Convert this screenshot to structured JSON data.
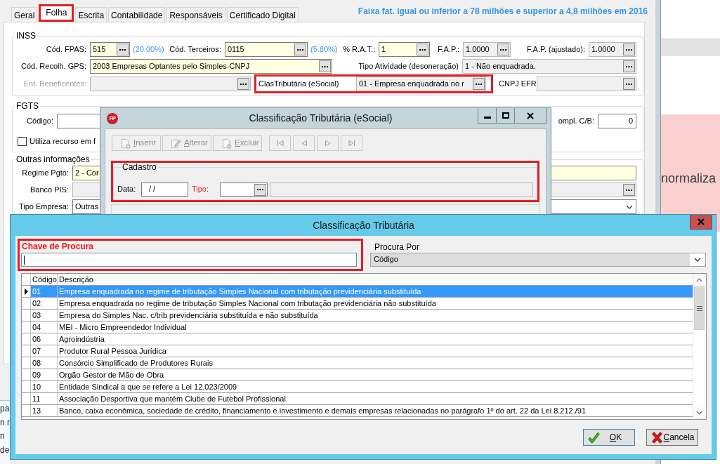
{
  "main_window": {
    "tabs": [
      {
        "label": "Geral",
        "selected": false,
        "highlighted": false
      },
      {
        "label": "Folha",
        "selected": true,
        "highlighted": true
      },
      {
        "label": "Escrita",
        "selected": false,
        "highlighted": false
      },
      {
        "label": "Contabilidade",
        "selected": false,
        "highlighted": false
      },
      {
        "label": "Responsáveis",
        "selected": false,
        "highlighted": false
      },
      {
        "label": "Certificado Digital",
        "selected": false,
        "highlighted": false
      }
    ],
    "notice": "Faixa fat. igual ou inferior a 78 milhões e superior a 4,8 milhões em 2016",
    "inss": {
      "title": "INSS",
      "fpas": {
        "label": "Cód. FPAS:",
        "value": "515",
        "kind": "required",
        "rate": "(20.00%)"
      },
      "third_parties": {
        "label": "Cód. Terceiros:",
        "value": "0115",
        "kind": "required",
        "rate": "(5.80%)"
      },
      "rat": {
        "label": "% R.A.T.:",
        "value": "1",
        "kind": "required"
      },
      "fap": {
        "label": "F.A.P.:",
        "value": "1.0000",
        "kind": "readonly"
      },
      "fap_adjusted": {
        "label": "F.A.P. (ajustado):",
        "value": "1.0000",
        "kind": "readonly"
      },
      "gps_code": {
        "label": "Cód. Recolh. GPS:",
        "value": "2003 Empresas Optantes pelo Simples-CNPJ",
        "kind": "required"
      },
      "activity_type": {
        "label": "Tipo Atividade (desoneração)",
        "value": "1 - Não enquadrada.",
        "kind": "readonly"
      },
      "beneficent": {
        "label": "Ent. Beneficentes:",
        "kind": "readonly",
        "disabled": true
      },
      "tax_class": {
        "label": "ClasTributária (eSocial)",
        "value": "01 - Empresa enquadrada no r",
        "kind": "readonly",
        "highlighted": true
      },
      "cnpj_efr": {
        "label": "CNPJ EFR",
        "kind": "readonly"
      }
    },
    "fgts": {
      "title": "FGTS",
      "code": {
        "label": "Código:",
        "kind": "plain"
      },
      "uses_resource": {
        "label": "Utiliza recurso em f",
        "checked": false
      },
      "compl_cb": {
        "label": "ompl. C/B:",
        "value": "0",
        "kind": "plain"
      }
    },
    "other_info": {
      "title": "Outras informações",
      "payment_regime": {
        "label": "Regime Pgto:",
        "value": "2 - Cor",
        "kind": "required"
      },
      "pis_bank": {
        "label": "Banco PIS:",
        "kind": "readonly"
      },
      "company_type": {
        "label": "Tipo Empresa:",
        "value": "Outras",
        "kind": "plain"
      }
    }
  },
  "side_window": {
    "banner": "normaliza"
  },
  "back_window": {
    "lines": [
      "pa",
      "n r",
      "n",
      "de"
    ]
  },
  "esocial_dialog": {
    "logo": "FP",
    "title": "Classificação Tributária (eSocial)",
    "toolbar": [
      {
        "label": "Inserir",
        "kind": "insert",
        "disabled": true,
        "mnemonic": true
      },
      {
        "label": "Alterar",
        "kind": "edit",
        "disabled": true,
        "mnemonic": true
      },
      {
        "label": "Excluir",
        "kind": "delete",
        "disabled": true,
        "mnemonic": true
      }
    ],
    "navigator": [
      {
        "kind": "first",
        "disabled": true
      },
      {
        "kind": "prev",
        "disabled": true
      },
      {
        "kind": "next",
        "disabled": true
      },
      {
        "kind": "last",
        "disabled": true
      }
    ],
    "record": {
      "title": "Cadastro",
      "highlighted": true,
      "date": {
        "label": "Data:",
        "value": "/ /",
        "required": false
      },
      "type": {
        "label": "Tipo:",
        "required": true
      }
    }
  },
  "lookup_dialog": {
    "title": "Classificação Tributária",
    "search_key": {
      "label": "Chave de Procura",
      "required": true,
      "highlighted": true
    },
    "search_by": {
      "label": "Procura Por",
      "value": "Código"
    },
    "table": {
      "columns": [
        "Código",
        "Descrição"
      ],
      "rows": [
        {
          "code": "01",
          "description": "Empresa enquadrada no regime de tributação Simples Nacional com tributação previdenciária substituída",
          "selected": true
        },
        {
          "code": "02",
          "description": "Empresa enquadrada no regime de tributação Simples Nacional com tributação previdenciária não substituída",
          "selected": false
        },
        {
          "code": "03",
          "description": "Empresa do Simples Nac. c/trib previdenciária substituída e não substituída",
          "selected": false
        },
        {
          "code": "04",
          "description": "MEI - Micro Empreendedor Individual",
          "selected": false
        },
        {
          "code": "06",
          "description": "Agroindústria",
          "selected": false
        },
        {
          "code": "07",
          "description": "Produtor Rural Pessoa Jurídica",
          "selected": false
        },
        {
          "code": "08",
          "description": "Consórcio Simplificado de Produtores Rurais",
          "selected": false
        },
        {
          "code": "09",
          "description": "Orgão Gestor de Mão de Obra",
          "selected": false
        },
        {
          "code": "10",
          "description": "Entidade Sindical a que se refere a Lei 12.023/2009",
          "selected": false
        },
        {
          "code": "11",
          "description": "Associação Desportiva que mantém Clube de Futebol Profissional",
          "selected": false
        },
        {
          "code": "13",
          "description": "Banco, caixa econômica, sociedade de crédito, financiamento e investimento e demais empresas relacionadas no parágrafo 1º do art. 22 da Lei 8.212./91",
          "selected": false
        }
      ]
    },
    "buttons": [
      {
        "label": "OK",
        "kind": "ok",
        "default": true,
        "mnemonic": true
      },
      {
        "label": "Cancela",
        "kind": "cancel",
        "default": false,
        "mnemonic": true
      }
    ]
  }
}
